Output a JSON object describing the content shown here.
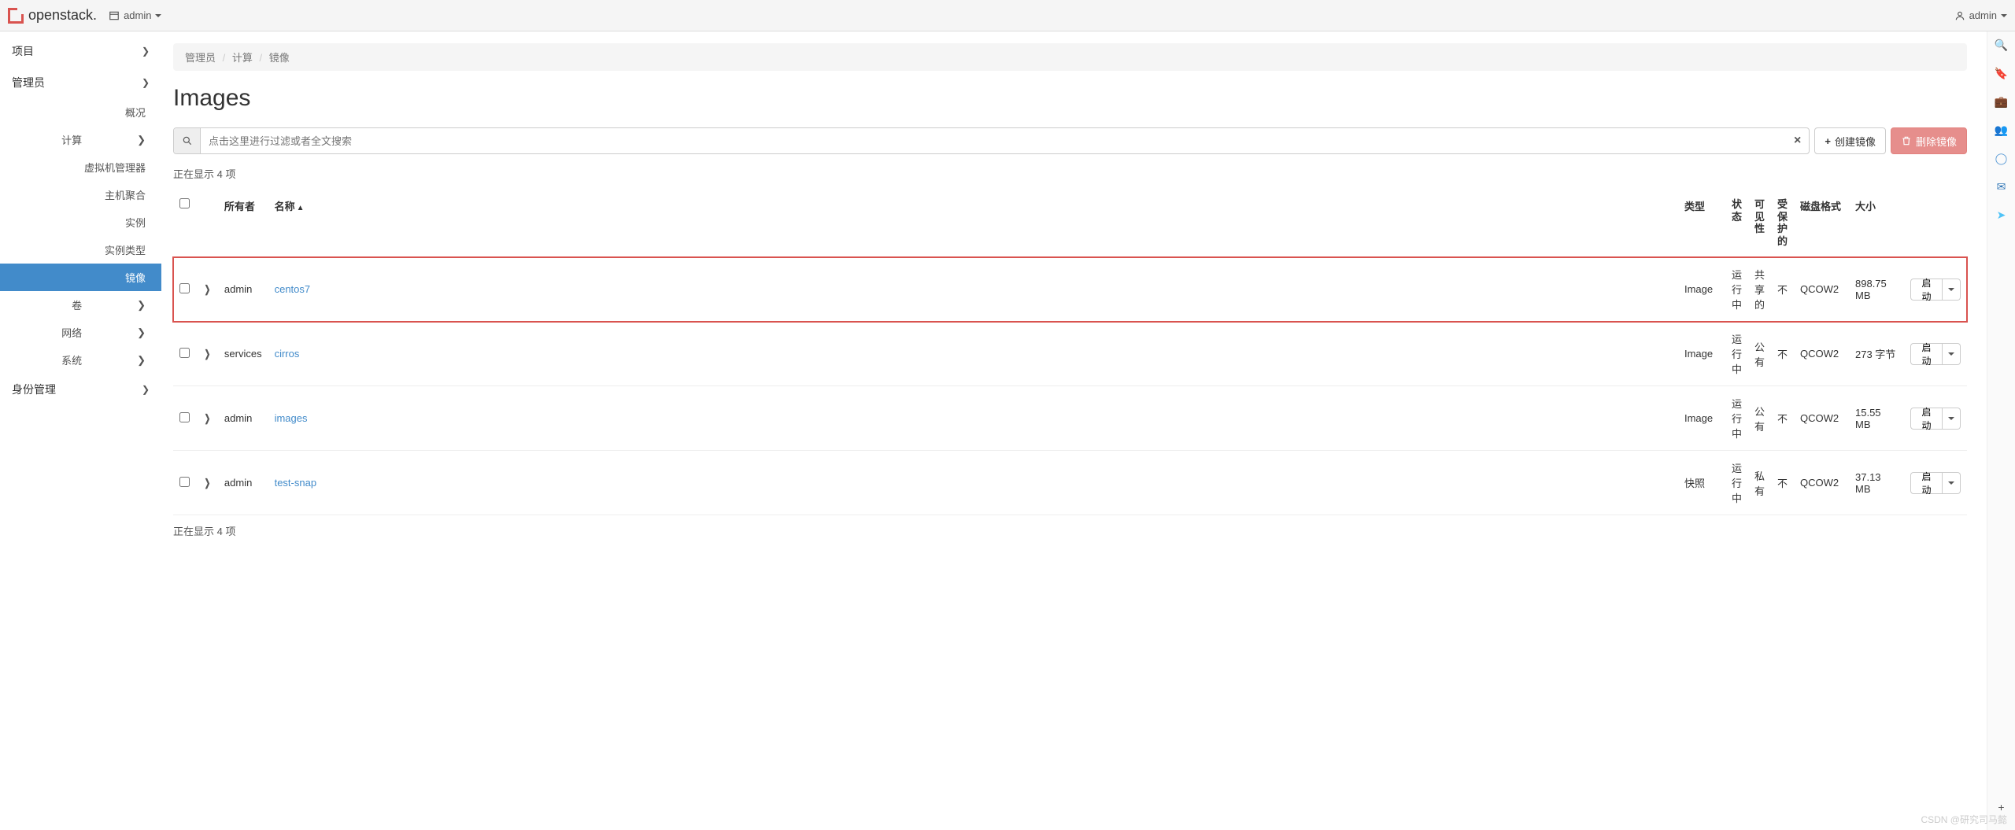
{
  "brand": "openstack.",
  "project_selector": {
    "label": "admin"
  },
  "user_menu": {
    "label": "admin"
  },
  "sidebar": {
    "project": "项目",
    "admin": "管理员",
    "overview": "概况",
    "compute": "计算",
    "hypervisors": "虚拟机管理器",
    "aggregates": "主机聚合",
    "instances": "实例",
    "flavors": "实例类型",
    "images": "镜像",
    "volumes": "卷",
    "network": "网络",
    "system": "系统",
    "identity": "身份管理"
  },
  "breadcrumb": {
    "a": "管理员",
    "b": "计算",
    "c": "镜像"
  },
  "page_title": "Images",
  "search": {
    "placeholder": "点击这里进行过滤或者全文搜索"
  },
  "buttons": {
    "create": "创建镜像",
    "delete": "删除镜像",
    "launch": "启动"
  },
  "count_text_top": "正在显示 4 项",
  "count_text_bottom": "正在显示 4 项",
  "columns": {
    "owner": "所有者",
    "name": "名称",
    "type": "类型",
    "status": "状态",
    "visibility": "可见性",
    "protected": "受保护的",
    "disk_format": "磁盘格式",
    "size": "大小"
  },
  "rows": [
    {
      "owner": "admin",
      "name": "centos7",
      "type": "Image",
      "status": "运行中",
      "visibility": "共享的",
      "protected": "不",
      "disk_format": "QCOW2",
      "size": "898.75 MB",
      "highlight": true
    },
    {
      "owner": "services",
      "name": "cirros",
      "type": "Image",
      "status": "运行中",
      "visibility": "公有",
      "protected": "不",
      "disk_format": "QCOW2",
      "size": "273 字节",
      "highlight": false
    },
    {
      "owner": "admin",
      "name": "images",
      "type": "Image",
      "status": "运行中",
      "visibility": "公有",
      "protected": "不",
      "disk_format": "QCOW2",
      "size": "15.55 MB",
      "highlight": false
    },
    {
      "owner": "admin",
      "name": "test-snap",
      "type": "快照",
      "status": "运行中",
      "visibility": "私有",
      "protected": "不",
      "disk_format": "QCOW2",
      "size": "37.13 MB",
      "highlight": false
    }
  ],
  "watermark": "CSDN @研究司马懿"
}
